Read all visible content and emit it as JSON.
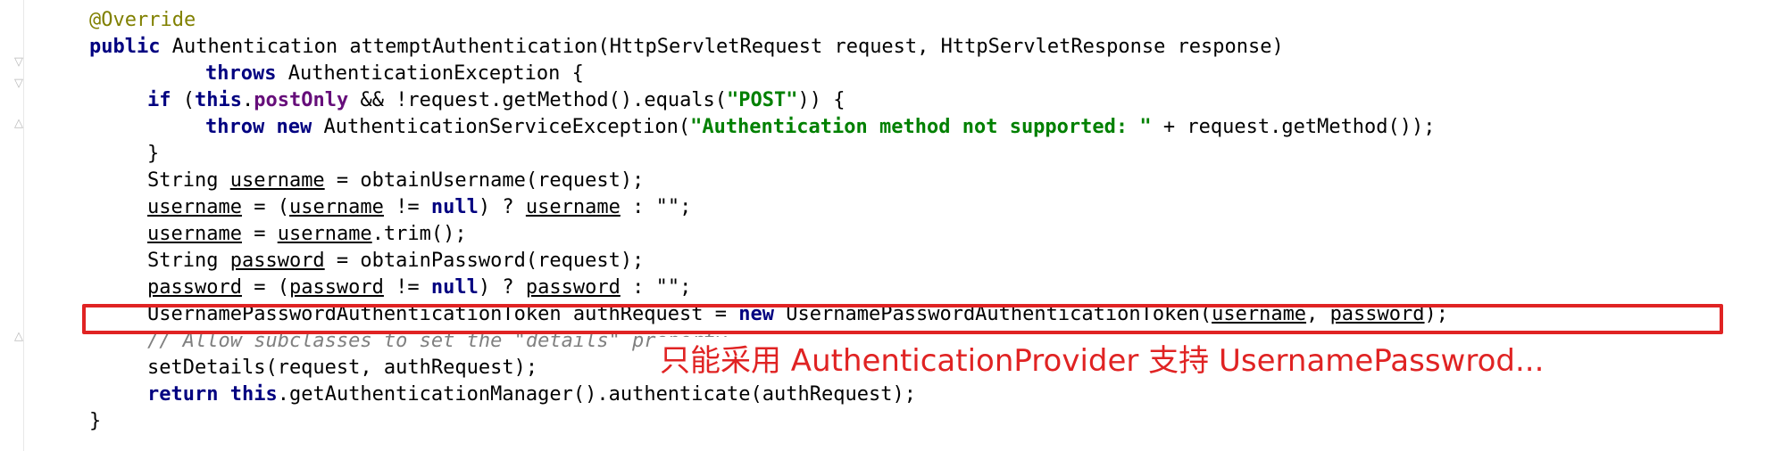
{
  "code": {
    "annotation": "@Override",
    "kw_public": "public",
    "sig_rest": " Authentication attemptAuthentication(HttpServletRequest request, HttpServletResponse response)",
    "kw_throws": "throws",
    "throws_rest": " AuthenticationException {",
    "kw_if": "if",
    "if_open": " (",
    "kw_this": "this",
    "field_postOnly": "postOnly",
    "if_mid": " && !request.getMethod().equals(",
    "str_post": "\"POST\"",
    "if_end": ")) {",
    "kw_throw": "throw",
    "kw_new": "new",
    "throw_class": " AuthenticationServiceException(",
    "str_msg": "\"Authentication method not supported: \"",
    "throw_end": " + request.getMethod());",
    "close_brace": "}",
    "type_string": "String ",
    "var_username": "username",
    "user_assign": " = obtainUsername(request);",
    "eq_paren": " = (",
    "kw_null": "null",
    "neq": " != ",
    "ternary": ") ? ",
    "colon_empty": " : \"\";",
    "eq": " = ",
    "trim_call": ".trim();",
    "var_password": "password",
    "pass_assign": " = obtainPassword(request);",
    "token_decl": "UsernamePasswordAuthenticationToken authRequest = ",
    "token_ctor": " UsernamePasswordAuthenticationToken(",
    "comma": ", ",
    "token_end": ");",
    "comment": "// Allow subclasses to set the \"details\" property",
    "set_details": "setDetails(request, authRequest);",
    "kw_return": "return",
    "return_rest": ".getAuthenticationManager().authenticate(authRequest);",
    "method_close": "}"
  },
  "annotation_note": "只能采用 AuthenticationProvider 支持 UsernamePasswrod...",
  "colors": {
    "highlight_border": "#e02323",
    "keyword": "#000080",
    "string": "#008000",
    "field": "#660e7a",
    "comment": "#808080",
    "annotation": "#808000"
  },
  "icons": [
    "fold-marker-icon"
  ]
}
